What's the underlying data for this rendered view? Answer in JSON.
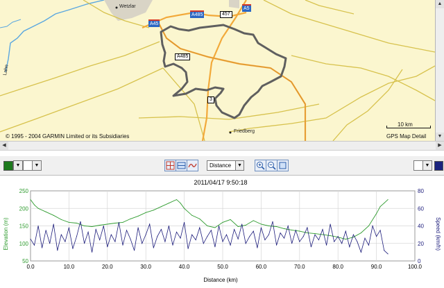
{
  "map": {
    "places": [
      "Wetzlar",
      "Friedberg",
      "Lahn"
    ],
    "shields": {
      "a485_top": "A485",
      "a45": "A45",
      "r457": "457",
      "a5": "A5",
      "a485_mid": "A485",
      "r3": "3"
    },
    "copyright": "© 1995 - 2004 GARMIN Limited or its Subsidiaries",
    "scale_label": "10 km",
    "detail_label": "GPS Map Detail",
    "colors": {
      "background": "#fbf6cf",
      "major_road": "#f2a93a",
      "minor_road": "#d7c24d",
      "water": "#5aa7e0",
      "track": "#5f5f5f"
    }
  },
  "scrollbars": {
    "up": "▲",
    "down": "▼",
    "left": "◀",
    "right": "▶"
  },
  "toolbar": {
    "left_color": "#1d7a1d",
    "right_color": "#1a237e",
    "dropdown_arrow": "▼",
    "axis_mode": "Distance",
    "buttons": [
      "crosshair-icon",
      "split-view-icon",
      "smooth-curve-icon",
      "zoom-in-icon",
      "zoom-out-icon",
      "zoom-fit-icon"
    ]
  },
  "chart_data": {
    "type": "line",
    "title": "2011/04/17 9:50:18",
    "xlabel": "Distance (km)",
    "ylabel_left": "Elevation (m)",
    "ylabel_right": "Speed (km/h)",
    "xlim": [
      0,
      100
    ],
    "ylim_left": [
      50,
      250
    ],
    "ylim_right": [
      0,
      80
    ],
    "x_ticks": [
      "0.0",
      "10.0",
      "20.0",
      "30.0",
      "40.0",
      "50.0",
      "60.0",
      "70.0",
      "80.0",
      "90.0",
      "100.0"
    ],
    "y_ticks_left": [
      "50",
      "100",
      "150",
      "200",
      "250"
    ],
    "y_ticks_right": [
      "0",
      "20",
      "40",
      "60",
      "80"
    ],
    "grid": true,
    "series": [
      {
        "axis": "left",
        "color": "#2e9b2e",
        "x": [
          0,
          1,
          2,
          4,
          6,
          8,
          10,
          12,
          14,
          16,
          18,
          20,
          22,
          24,
          26,
          28,
          30,
          32,
          34,
          36,
          38,
          39,
          40,
          42,
          44,
          46,
          48,
          50,
          52,
          54,
          56,
          58,
          60,
          62,
          64,
          66,
          68,
          70,
          72,
          74,
          76,
          78,
          80,
          82,
          84,
          86,
          88,
          90,
          91,
          92,
          93
        ],
        "y": [
          225,
          210,
          200,
          190,
          180,
          168,
          160,
          158,
          150,
          148,
          152,
          155,
          158,
          160,
          170,
          178,
          188,
          195,
          205,
          215,
          225,
          215,
          200,
          180,
          170,
          150,
          145,
          160,
          168,
          148,
          152,
          165,
          155,
          150,
          148,
          142,
          138,
          135,
          130,
          128,
          125,
          122,
          118,
          112,
          118,
          130,
          150,
          185,
          205,
          215,
          225
        ]
      },
      {
        "axis": "right",
        "color": "#1a1a7a",
        "x": [
          0,
          1,
          2,
          3,
          4,
          5,
          6,
          7,
          8,
          9,
          10,
          11,
          12,
          13,
          14,
          15,
          16,
          17,
          18,
          19,
          20,
          21,
          22,
          23,
          24,
          25,
          26,
          27,
          28,
          29,
          30,
          31,
          32,
          33,
          34,
          35,
          36,
          37,
          38,
          39,
          40,
          41,
          42,
          43,
          44,
          45,
          46,
          47,
          48,
          49,
          50,
          51,
          52,
          53,
          54,
          55,
          56,
          57,
          58,
          59,
          60,
          61,
          62,
          63,
          64,
          65,
          66,
          67,
          68,
          69,
          70,
          71,
          72,
          73,
          74,
          75,
          76,
          77,
          78,
          79,
          80,
          81,
          82,
          83,
          84,
          85,
          86,
          87,
          88,
          89,
          90,
          91,
          92,
          93
        ],
        "y": [
          25,
          18,
          40,
          15,
          35,
          20,
          42,
          12,
          30,
          22,
          38,
          14,
          28,
          45,
          20,
          33,
          10,
          36,
          24,
          40,
          16,
          30,
          22,
          44,
          18,
          35,
          25,
          12,
          38,
          20,
          30,
          42,
          15,
          28,
          36,
          22,
          40,
          18,
          33,
          26,
          44,
          14,
          30,
          24,
          38,
          20,
          28,
          35,
          16,
          40,
          22,
          30,
          18,
          36,
          25,
          42,
          20,
          28,
          34,
          15,
          38,
          24,
          30,
          45,
          18,
          32,
          26,
          40,
          20,
          35,
          22,
          28,
          38,
          16,
          30,
          24,
          36,
          18,
          42,
          22,
          28,
          20,
          34,
          16,
          30,
          22,
          10,
          26,
          18,
          40,
          28,
          35,
          12,
          8
        ]
      }
    ]
  }
}
